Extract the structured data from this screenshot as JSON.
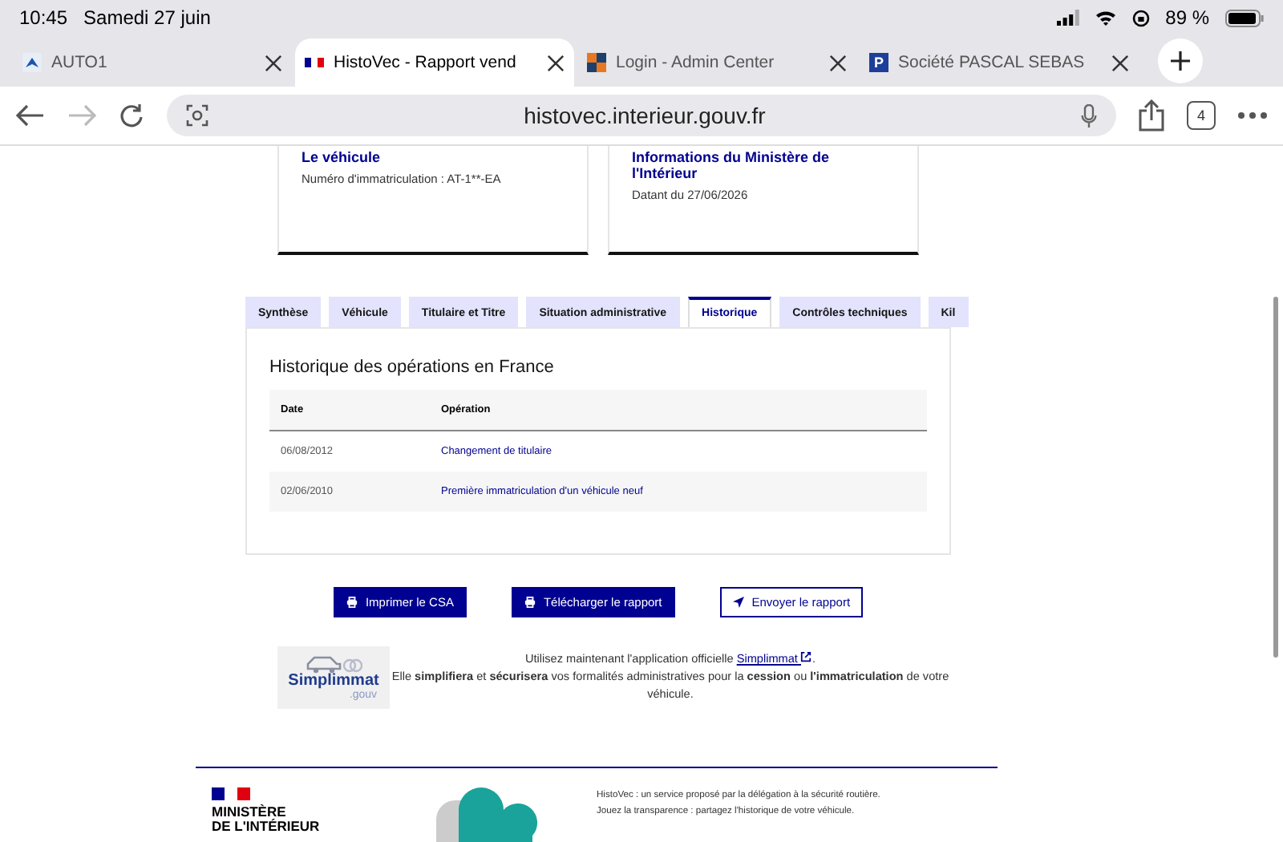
{
  "status_bar": {
    "time": "10:45",
    "date": "Samedi 27 juin",
    "battery": "89 %"
  },
  "browser_tabs": [
    {
      "title": "AUTO1",
      "selected": false
    },
    {
      "title": "HistoVec - Rapport vend",
      "selected": true
    },
    {
      "title": "Login - Admin Center",
      "selected": false
    },
    {
      "title": "Société PASCAL SEBAS",
      "selected": false,
      "favicon_letter": "P"
    }
  ],
  "toolbar": {
    "url": "histovec.interieur.gouv.fr",
    "tab_count": "4"
  },
  "cards": [
    {
      "title": "Le véhicule",
      "detail": "Numéro d'immatriculation : AT-1**-EA"
    },
    {
      "title": "Informations du Ministère de l'Intérieur",
      "detail": "Datant du 27/06/2026"
    }
  ],
  "report_tabs": [
    {
      "label": "Synthèse",
      "selected": false
    },
    {
      "label": "Véhicule",
      "selected": false
    },
    {
      "label": "Titulaire et Titre",
      "selected": false
    },
    {
      "label": "Situation administrative",
      "selected": false
    },
    {
      "label": "Historique",
      "selected": true
    },
    {
      "label": "Contrôles techniques",
      "selected": false
    },
    {
      "label": "Kil",
      "selected": false
    }
  ],
  "history": {
    "title": "Historique des opérations en France",
    "columns": [
      "Date",
      "Opération"
    ],
    "rows": [
      {
        "date": "06/08/2012",
        "operation": "Changement de titulaire"
      },
      {
        "date": "02/06/2010",
        "operation": "Première immatriculation d'un véhicule neuf"
      }
    ]
  },
  "actions": [
    {
      "label": "Imprimer le CSA",
      "kind": "primary"
    },
    {
      "label": "Télécharger le rapport",
      "kind": "primary"
    },
    {
      "label": "Envoyer le rapport",
      "kind": "secondary"
    }
  ],
  "promo": {
    "logo_name": "Simplimmat",
    "logo_suffix": ".gouv",
    "lead": "Utilisez maintenant l'application officielle",
    "link": "Simplimmat",
    "lead_end": ".",
    "text": "Elle **simplifiera** et **sécurisera** vos formalités administratives pour la **cession** ou **l'immatriculation** de votre véhicule."
  },
  "footer": {
    "ministry": [
      "MINISTÈRE",
      "DE L'INTÉRIEUR"
    ],
    "lines": [
      "HistoVec : un service proposé par la délégation à la sécurité routière.",
      "Jouez la transparence : partagez l'historique de votre véhicule."
    ]
  }
}
